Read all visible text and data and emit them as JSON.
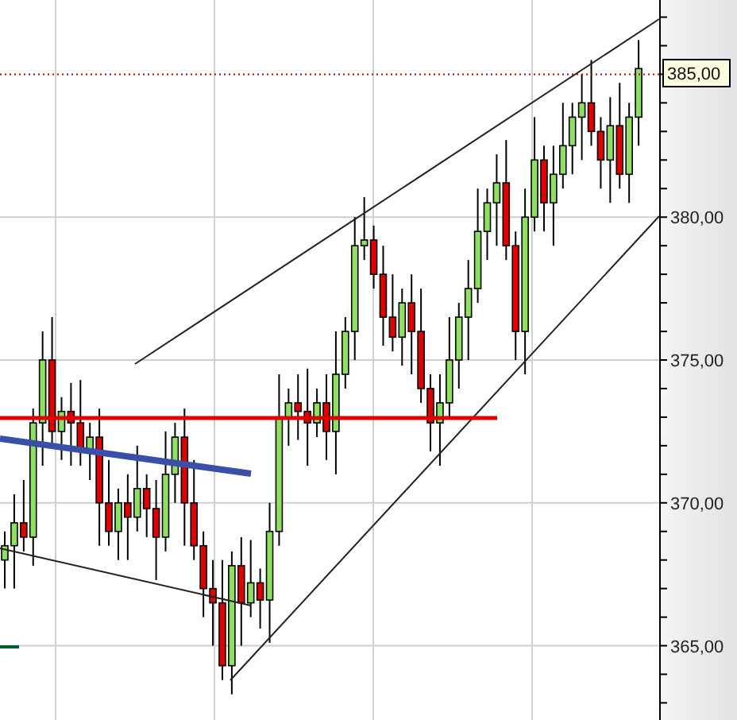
{
  "last_price": {
    "label": "385,00"
  },
  "chart_data": {
    "type": "candlestick",
    "grid": true,
    "ylim": [
      362.4,
      387.6
    ],
    "ref_lines": [
      {
        "axis": "y",
        "value": 385,
        "color": "#c00000"
      }
    ],
    "yticks": [
      {
        "value": 365,
        "label": "365,00"
      },
      {
        "value": 370,
        "label": "370,00"
      },
      {
        "value": 375,
        "label": "375,00"
      },
      {
        "value": 380,
        "label": "380,00"
      }
    ],
    "ohlc": [
      [
        368,
        369,
        367,
        368.5
      ],
      [
        368.5,
        370.3,
        367,
        369.3
      ],
      [
        369.3,
        370.8,
        368.3,
        368.8
      ],
      [
        368.8,
        373.3,
        367.8,
        372.8
      ],
      [
        372.8,
        376,
        371.3,
        375
      ],
      [
        375,
        376.5,
        372,
        372.5
      ],
      [
        372.5,
        373.7,
        371.5,
        373.2
      ],
      [
        373.2,
        374.2,
        371.3,
        372.8
      ],
      [
        372.8,
        374.3,
        371.3,
        371.8
      ],
      [
        371.8,
        372.8,
        370.8,
        372.3
      ],
      [
        372.3,
        373.3,
        368.5,
        370
      ],
      [
        370,
        371.5,
        368.5,
        369
      ],
      [
        369,
        370.5,
        368,
        370
      ],
      [
        370,
        371,
        368,
        369.5
      ],
      [
        369.5,
        372,
        369,
        370.5
      ],
      [
        370.5,
        371,
        368.8,
        369.8
      ],
      [
        369.8,
        370.8,
        367.3,
        368.8
      ],
      [
        368.8,
        372.5,
        368.3,
        371
      ],
      [
        371,
        372.8,
        370,
        372.3
      ],
      [
        372.3,
        373.3,
        368.5,
        370
      ],
      [
        370,
        371.5,
        368,
        368.5
      ],
      [
        368.5,
        369,
        366,
        367
      ],
      [
        367,
        368,
        365,
        366.5
      ],
      [
        366.5,
        368,
        363.8,
        364.3
      ],
      [
        364.3,
        368.3,
        363.3,
        367.8
      ],
      [
        367.8,
        368.8,
        365,
        366.5
      ],
      [
        366.5,
        368.7,
        366,
        367.2
      ],
      [
        367.2,
        367.7,
        365.6,
        366.6
      ],
      [
        366.6,
        370,
        365.1,
        369
      ],
      [
        369,
        374.5,
        368.5,
        373
      ],
      [
        373,
        374,
        372,
        373.5
      ],
      [
        373.5,
        374.5,
        372.2,
        373.2
      ],
      [
        373.2,
        374.7,
        371.3,
        372.8
      ],
      [
        372.8,
        374,
        372.3,
        373.5
      ],
      [
        373.5,
        374.5,
        371.5,
        372.5
      ],
      [
        372.5,
        376,
        371,
        374.5
      ],
      [
        374.5,
        376.5,
        374,
        376
      ],
      [
        376,
        380,
        375,
        379
      ],
      [
        379,
        380.7,
        378.5,
        379.2
      ],
      [
        379.2,
        379.7,
        377.5,
        378
      ],
      [
        378,
        379,
        375.5,
        376.5
      ],
      [
        376.5,
        378,
        375.3,
        375.8
      ],
      [
        375.8,
        377.5,
        374.8,
        377
      ],
      [
        377,
        378,
        374.5,
        376
      ],
      [
        376,
        377.5,
        373.5,
        374
      ],
      [
        374,
        374.5,
        371.8,
        372.8
      ],
      [
        372.8,
        374.5,
        371.3,
        373.5
      ],
      [
        373.5,
        376.5,
        373,
        375
      ],
      [
        375,
        377,
        374,
        376.5
      ],
      [
        376.5,
        378.5,
        375,
        377.5
      ],
      [
        377.5,
        381,
        377,
        379.5
      ],
      [
        379.5,
        381,
        378.5,
        380.5
      ],
      [
        380.5,
        382.2,
        379,
        381.2
      ],
      [
        381.2,
        382.7,
        378.5,
        379
      ],
      [
        379,
        379.5,
        375,
        376
      ],
      [
        376,
        381,
        374.5,
        380
      ],
      [
        380,
        383.5,
        379.5,
        382
      ],
      [
        382,
        382.5,
        379.5,
        380.5
      ],
      [
        380.5,
        382.5,
        379,
        381.5
      ],
      [
        381.5,
        384,
        381,
        382.5
      ],
      [
        382.5,
        384,
        381.5,
        383.5
      ],
      [
        383.5,
        385,
        382,
        384
      ],
      [
        384,
        385.5,
        382.5,
        383
      ],
      [
        383,
        383.5,
        381,
        382
      ],
      [
        382,
        384.2,
        380.5,
        383.2
      ],
      [
        383.2,
        384.7,
        381,
        381.5
      ],
      [
        381.5,
        384,
        380.5,
        383.5
      ],
      [
        383.5,
        386.2,
        382.5,
        385.2
      ]
    ]
  }
}
